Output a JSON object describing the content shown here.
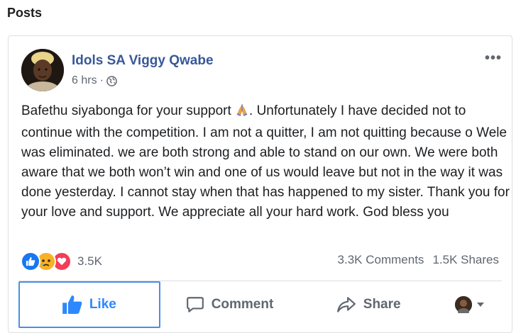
{
  "section": {
    "title": "Posts"
  },
  "post": {
    "author": "Idols SA Viggy Qwabe",
    "time": "6 hrs",
    "separator": "·",
    "body_before_emoji": "Bafethu siyabonga for your support ",
    "body_after_emoji": ". Unfortunately I have decided not to continue with the competition. I am not a quitter, I am not quitting because o Wele was eliminated. we are both strong and able to stand on our own. We were both aware that we both won’t win and one of us would leave but not in the way it was done yesterday. I cannot stay when that has happened to my sister. Thank you for your love and support. We appreciate all your hard work. God bless you",
    "more_label": "•••",
    "reaction_count": "3.5K",
    "comments": "3.3K Comments",
    "shares": "1.5K Shares",
    "reaction_icons": [
      "like-icon",
      "sad-icon",
      "love-icon"
    ]
  },
  "actions": {
    "like": "Like",
    "comment": "Comment",
    "share": "Share"
  },
  "colors": {
    "link": "#385898",
    "like_active": "#2d88ff",
    "muted": "#606770",
    "love": "#f33e58",
    "sad": "#f7b125"
  }
}
